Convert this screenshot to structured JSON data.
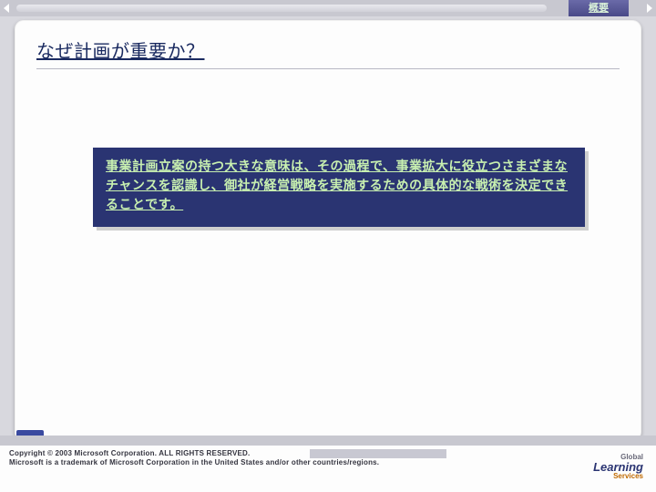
{
  "topbar": {
    "tab_label": "概要"
  },
  "slide": {
    "heading": "なぜ計画が重要か？",
    "highlight": "事業計画立案の持つ大きな意味は、その過程で、事業拡大に役立つさまざまなチャンスを認識し、御社が経営戦略を実施するための具体的な戦術を決定できることです。"
  },
  "footer": {
    "legal_line1": "Copyright © 2003 Microsoft Corporation. ALL RIGHTS RESERVED.",
    "legal_line2": "Microsoft is a trademark of Microsoft Corporation in the United States and/or other countries/regions.",
    "brand_top": "Global",
    "brand_main": "Learning",
    "brand_sub": "Services"
  }
}
